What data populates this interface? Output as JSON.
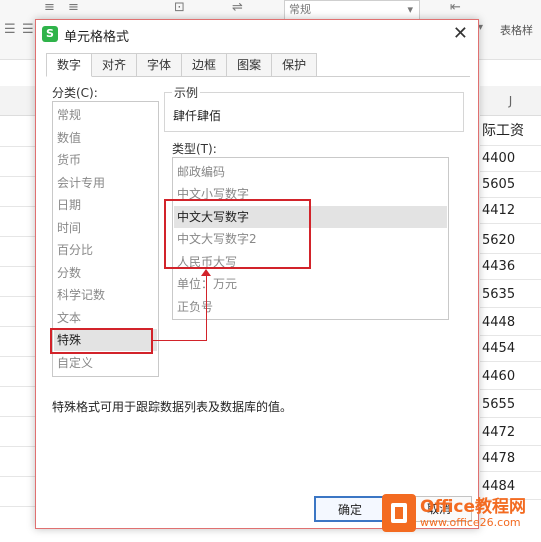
{
  "ribbon": {
    "format_box": "常规",
    "table_style_label": "表格样"
  },
  "sheet": {
    "column_header": "J",
    "column_title": "际工资",
    "values": [
      "4400",
      "5605",
      "4412",
      "5620",
      "4436",
      "5635",
      "4448",
      "4454",
      "4460",
      "5655",
      "4472",
      "4478",
      "4484"
    ]
  },
  "dialog": {
    "title": "单元格格式",
    "close_glyph": "✕",
    "tabs": [
      "数字",
      "对齐",
      "字体",
      "边框",
      "图案",
      "保护"
    ],
    "active_tab": "数字",
    "category_label": "分类(C):",
    "categories": [
      "常规",
      "数值",
      "货币",
      "会计专用",
      "日期",
      "时间",
      "百分比",
      "分数",
      "科学记数",
      "文本",
      "特殊",
      "自定义"
    ],
    "selected_category": "特殊",
    "sample_label": "示例",
    "sample_value": "肆仟肆佰",
    "type_label": "类型(T):",
    "types": [
      "邮政编码",
      "中文小写数字",
      "中文大写数字",
      "中文大写数字2",
      "人民币大写",
      "单位：万元",
      "正负号"
    ],
    "selected_type": "中文大写数字",
    "description": "特殊格式可用于跟踪数据列表及数据库的值。",
    "ok_label": "确定",
    "cancel_label": "取消"
  },
  "watermark": {
    "title": "Office教程网",
    "url": "www.office26.com"
  }
}
